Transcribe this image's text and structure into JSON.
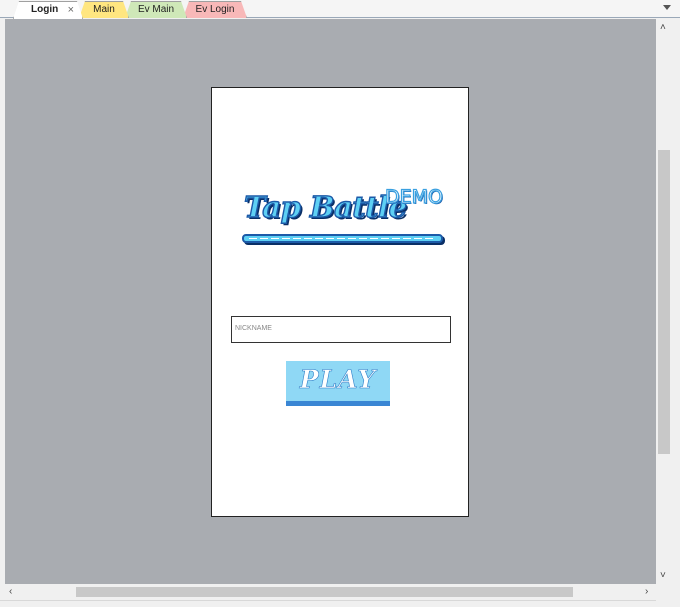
{
  "tabs": [
    {
      "label": "Login",
      "active": true,
      "color": "#ffffff"
    },
    {
      "label": "Main",
      "active": false,
      "color": "#ffe680"
    },
    {
      "label": "Ev Main",
      "active": false,
      "color": "#cfe8b8"
    },
    {
      "label": "Ev Login",
      "active": false,
      "color": "#f8b8b8"
    }
  ],
  "tab_close_glyph": "×",
  "screen": {
    "logo": {
      "title": "Tap Battle",
      "badge": "DEMO"
    },
    "nickname": {
      "placeholder": "NICKNAME",
      "value": ""
    },
    "play_button": {
      "label": "PLAY"
    }
  },
  "scrollbars": {
    "up": "˄",
    "down": "˅",
    "left": "‹",
    "right": "›"
  },
  "colors": {
    "canvas": "#a9acb1",
    "logo_fill": "#5ed0f4",
    "logo_outline": "#1c5aa8",
    "play_bg": "#8fd8f5",
    "play_bar": "#3a86d4"
  }
}
